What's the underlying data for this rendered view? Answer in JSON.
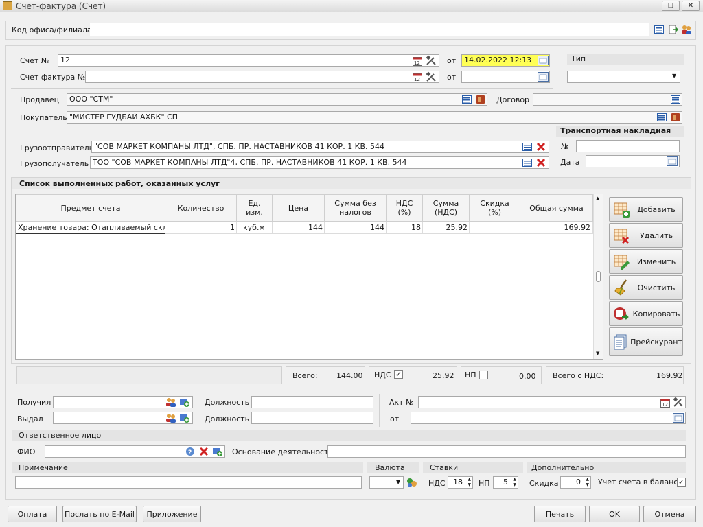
{
  "window": {
    "title": "Счет-фактура (Счет)"
  },
  "office": {
    "label": "Код офиса/филиала",
    "value": ""
  },
  "invoice": {
    "number_label": "Счет №",
    "number": "12",
    "from_label": "от",
    "date": "14.02.2022 12:13",
    "factura_label": "Счет фактура №",
    "factura": "",
    "factura_from_label": "от",
    "factura_date": "",
    "type_label": "Тип",
    "type_value": ""
  },
  "parties": {
    "seller_label": "Продавец",
    "seller": "ООО \"СТМ\"",
    "contract_label": "Договор",
    "contract": "",
    "buyer_label": "Покупатель",
    "buyer": "\"МИСТЕР ГУДБАЙ АХБК\" СП"
  },
  "shipping": {
    "consignor_label": "Грузоотправитель",
    "consignor": "\"СОВ МАРКЕТ КОМПАНЫ ЛТД\", СПБ. ПР. НАСТАВНИКОВ 41 КОР. 1 КВ. 544",
    "consignee_label": "Грузополучатель",
    "consignee": "ТОО \"СОВ МАРКЕТ КОМПАНЫ ЛТД\"4, СПБ. ПР. НАСТАВНИКОВ 41 КОР. 1 КВ. 544",
    "waybill_title": "Транспортная накладная",
    "waybill_no_label": "№",
    "waybill_no": "",
    "waybill_date_label": "Дата",
    "waybill_date": ""
  },
  "works": {
    "title": "Список выполненных работ, оказанных услуг",
    "columns": [
      "Предмет счета",
      "Количество",
      "Ед. изм.",
      "Цена",
      "Сумма без налогов",
      "НДС (%)",
      "Сумма (НДС)",
      "Скидка (%)",
      "Общая сумма"
    ],
    "rows": [
      [
        "Хранение товара: Отапливаемый склад (э",
        "1",
        "куб.м",
        "144",
        "144",
        "18",
        "25.92",
        "",
        "169.92"
      ]
    ],
    "buttons": {
      "add": "Добавить",
      "delete": "Удалить",
      "edit": "Изменить",
      "clear": "Очистить",
      "copy": "Копировать",
      "pricelist": "Прейскурант"
    }
  },
  "totals": {
    "total_label": "Всего:",
    "total": "144.00",
    "vat_label": "НДС",
    "vat_checked": "✓",
    "vat": "25.92",
    "np_label": "НП",
    "np": "0.00",
    "total_vat_label": "Всего с НДС:",
    "total_vat": "169.92"
  },
  "people": {
    "received_label": "Получил",
    "received": "",
    "position_label": "Должность",
    "position1": "",
    "position2": "",
    "issued_label": "Выдал",
    "issued": "",
    "act_label": "Акт №",
    "act": "",
    "act_from_label": "от",
    "act_date": ""
  },
  "responsible": {
    "title": "Ответственное лицо",
    "fio_label": "ФИО",
    "fio": "",
    "basis_label": "Основание деятельности",
    "basis": ""
  },
  "bottom": {
    "note_label": "Примечание",
    "note": "",
    "currency_label": "Валюта",
    "currency": "",
    "rates_label": "Ставки",
    "vat_label": "НДС",
    "vat_rate": "18",
    "np_label": "НП",
    "np_rate": "5",
    "extra_label": "Дополнительно",
    "discount_label": "Скидка",
    "discount": "0",
    "balance_label": "Учет счета в балансе",
    "balance_checked": "✓"
  },
  "footer": {
    "payment": "Оплата",
    "email": "Послать по E-Mail",
    "attachment": "Приложение",
    "print": "Печать",
    "ok": "OK",
    "cancel": "Отмена"
  }
}
